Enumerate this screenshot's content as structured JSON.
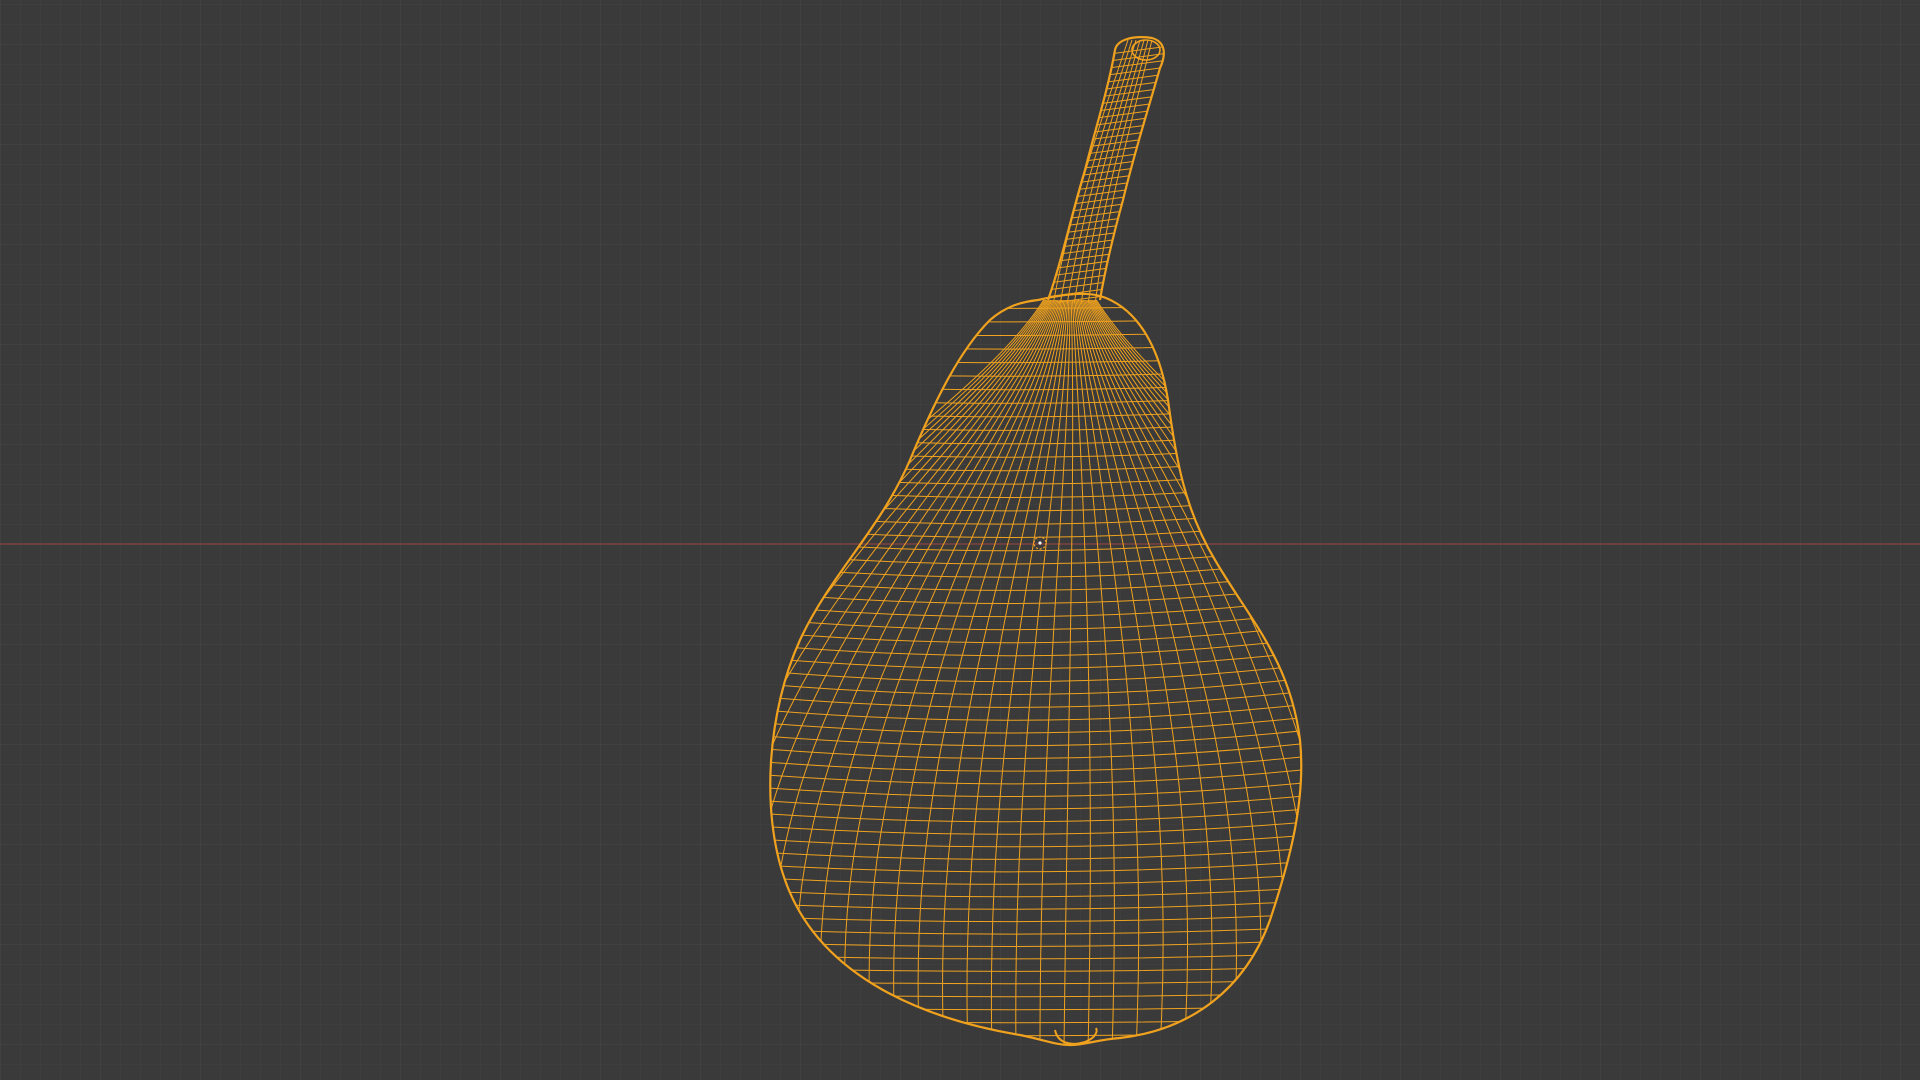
{
  "app": {
    "name": "3D viewport",
    "view": "wireframe"
  },
  "theme": {
    "background": "#3a3a3a",
    "grid_minor": "#414141",
    "grid_major": "#474747",
    "axis_x": "#8a4444",
    "wire": "#f0a21e",
    "wire_dark": "#b87412",
    "origin": "#e8a030"
  },
  "scene": {
    "object": "pear",
    "selected": true,
    "display_mode": "wireframe"
  },
  "icons": {
    "origin": "object-origin-icon",
    "cursor": "3d-cursor-icon"
  }
}
